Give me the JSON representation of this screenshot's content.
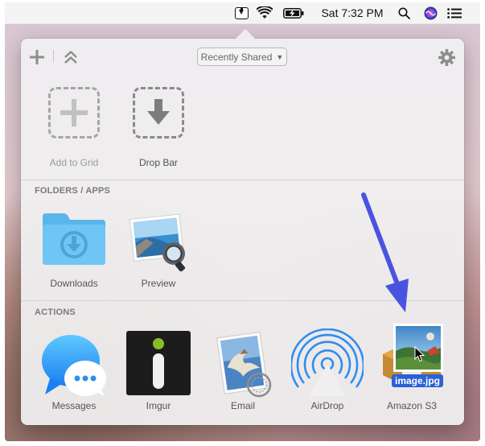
{
  "menubar": {
    "clock": "Sat 7:32 PM",
    "icons": [
      "dropzone-menubar-icon",
      "wifi-icon",
      "battery-charging-icon",
      "search-icon",
      "siri-icon",
      "notification-center-icon"
    ]
  },
  "toolbar": {
    "add_icon": "plus-icon",
    "collapse_icon": "chevron-up-double-icon",
    "dropdown_label": "Recently Shared",
    "dropdown_arrow": "▼",
    "settings_icon": "gear-icon"
  },
  "grid": {
    "items": [
      {
        "label": "Add to Grid",
        "icon": "add-plus-icon"
      },
      {
        "label": "Drop Bar",
        "icon": "drop-arrow-icon"
      }
    ]
  },
  "folders_apps": {
    "header": "FOLDERS / APPS",
    "items": [
      {
        "label": "Downloads",
        "icon": "downloads-folder-icon"
      },
      {
        "label": "Preview",
        "icon": "preview-app-icon"
      }
    ]
  },
  "actions": {
    "header": "ACTIONS",
    "items": [
      {
        "label": "Messages",
        "icon": "messages-icon"
      },
      {
        "label": "Imgur",
        "icon": "imgur-icon"
      },
      {
        "label": "Email",
        "icon": "mail-icon"
      },
      {
        "label": "AirDrop",
        "icon": "airdrop-icon"
      },
      {
        "label": "Amazon S3",
        "icon": "amazon-s3-icon"
      }
    ]
  },
  "drag": {
    "filename": "image.jpg"
  },
  "colors": {
    "accent_blue": "#2a62d6",
    "annotation_arrow": "#4a53e0",
    "panel_bg": "#f0eff0"
  }
}
